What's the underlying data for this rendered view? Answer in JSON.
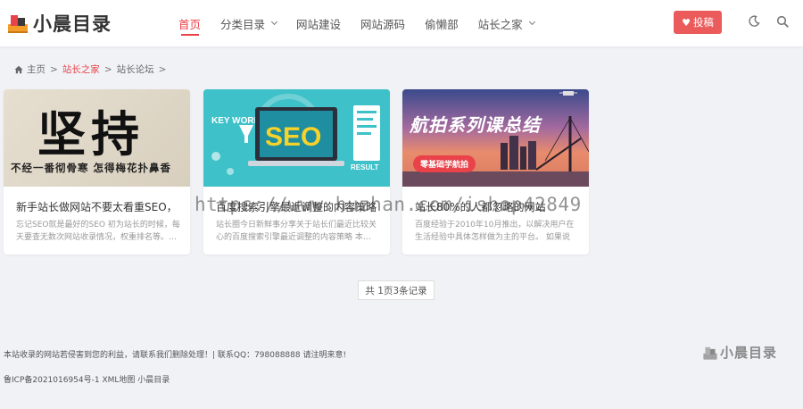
{
  "header": {
    "logo_text": "小晨目录",
    "nav": [
      {
        "label": "首页",
        "active": true,
        "dropdown": false
      },
      {
        "label": "分类目录",
        "active": false,
        "dropdown": true
      },
      {
        "label": "网站建设",
        "active": false,
        "dropdown": false
      },
      {
        "label": "网站源码",
        "active": false,
        "dropdown": false
      },
      {
        "label": "偷懒部",
        "active": false,
        "dropdown": false
      },
      {
        "label": "站长之家",
        "active": false,
        "dropdown": true
      }
    ],
    "submit_label": "投稿",
    "accent_color": "#e8424a",
    "button_color": "#ec5b5b",
    "icons": [
      "moon-icon",
      "search-icon"
    ]
  },
  "breadcrumb": {
    "home": "主页",
    "sep": ">",
    "level1": "站长之家",
    "level2": "站长论坛"
  },
  "cards": [
    {
      "image_big_text": "坚持",
      "image_small_text": "不经一番彻骨寒 怎得梅花扑鼻香",
      "title": "新手站长做网站不要太看重SEO，",
      "desc": "忘记SEO就是最好的SEO 初为站长的时候，每天要查无数次网站收录情况，权重排名等。…"
    },
    {
      "image_keyword_text": "KEY WORD",
      "image_seo_text": "SEO",
      "image_result_text": "RESULT",
      "title": "百度搜索引擎最近调整的内容策略",
      "desc": "站长圈今日新鲜事分享关于站长们最近比较关心的百度搜索引擎最近调整的内容策略 本…"
    },
    {
      "image_title_text": "航拍系列课总结",
      "image_badge_text": "零基础学航拍",
      "title": "站长80%的人都忽略的网站",
      "desc": "百度经验于2010年10月推出，以解决用户在生活经验中具体怎样做为主的平台。 如果说百…"
    }
  ],
  "pager": {
    "label": "共 1页3条记录"
  },
  "footer": {
    "line1": "本站收录的网站若侵害到您的利益，请联系我们删除处理！| 联系QQ：798088888 请注明来意!",
    "line2": "鲁ICP备2021016954号-1 XML地图 小晨目录",
    "logo_text": "小晨目录"
  },
  "watermark": "https://www.huzhan.com/ishop42849"
}
